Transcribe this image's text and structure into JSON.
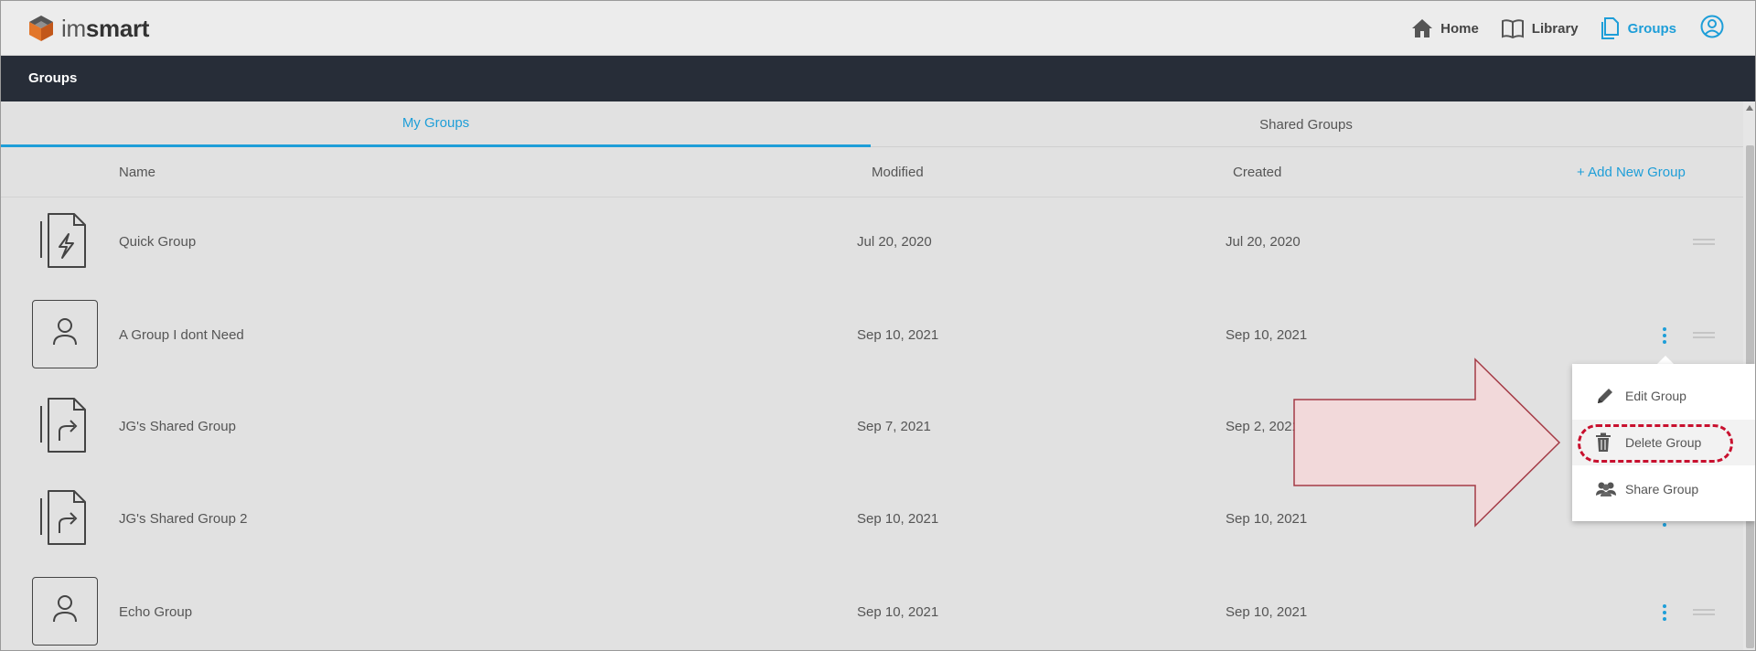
{
  "app": {
    "logo_thin": "im",
    "logo_bold": "smart"
  },
  "nav": {
    "home": "Home",
    "library": "Library",
    "groups": "Groups"
  },
  "page": {
    "title": "Groups"
  },
  "tabs": {
    "my_groups": "My Groups",
    "shared_groups": "Shared Groups"
  },
  "table": {
    "headers": {
      "name": "Name",
      "modified": "Modified",
      "created": "Created",
      "add_new": "+ Add New Group"
    },
    "rows": [
      {
        "name": "Quick Group",
        "modified": "Jul 20, 2020",
        "created": "Jul 20, 2020",
        "icon": "quick-group-icon"
      },
      {
        "name": "A Group I dont Need",
        "modified": "Sep 10, 2021",
        "created": "Sep 10, 2021",
        "icon": "user-icon"
      },
      {
        "name": "JG's Shared Group",
        "modified": "Sep 7, 2021",
        "created": "Sep 2, 2021",
        "icon": "shared-doc-icon"
      },
      {
        "name": "JG's Shared Group 2",
        "modified": "Sep 10, 2021",
        "created": "Sep 10, 2021",
        "icon": "shared-doc-icon"
      },
      {
        "name": "Echo Group",
        "modified": "Sep 10, 2021",
        "created": "Sep 10, 2021",
        "icon": "user-icon"
      }
    ]
  },
  "menu": {
    "edit": "Edit Group",
    "delete": "Delete Group",
    "share": "Share Group"
  },
  "colors": {
    "accent": "#1e9ed8",
    "header_dark": "#272d38",
    "highlight": "#c8102e",
    "callout_fill": "#f2d9da"
  }
}
